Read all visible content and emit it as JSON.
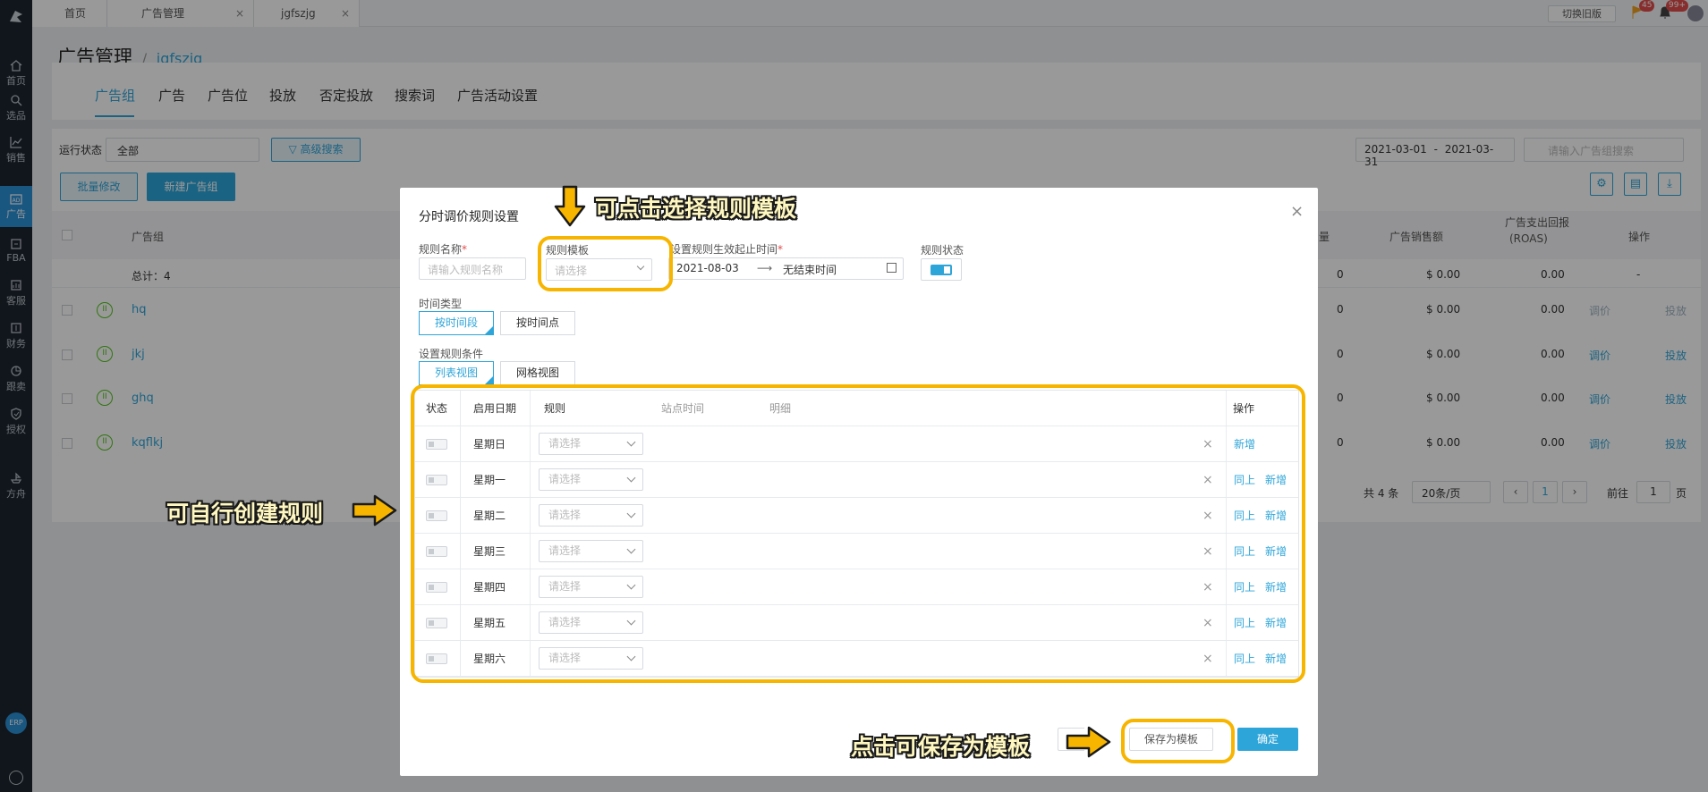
{
  "app": {
    "logo": "ERP"
  },
  "sidebar": {
    "items": [
      {
        "label": "首页",
        "icon": "home-icon"
      },
      {
        "label": "选品",
        "icon": "search-icon"
      },
      {
        "label": "销售",
        "icon": "chart-line-icon"
      },
      {
        "label": "广告",
        "icon": "ad-icon",
        "active": true
      },
      {
        "label": "FBA",
        "icon": "fba-icon"
      },
      {
        "label": "客服",
        "icon": "service-icon"
      },
      {
        "label": "财务",
        "icon": "finance-icon"
      },
      {
        "label": "跟卖",
        "icon": "follow-icon"
      },
      {
        "label": "授权",
        "icon": "shield-icon"
      },
      {
        "label": "方舟",
        "icon": "ark-icon"
      }
    ]
  },
  "page_tabs": [
    {
      "label": "首页"
    },
    {
      "label": "广告管理"
    },
    {
      "label": "jgfszjg"
    }
  ],
  "top_right": {
    "switch_label": "切换旧版",
    "flag_badge": "45",
    "bell_badge": "99+"
  },
  "breadcrumb": {
    "title": "广告管理",
    "sep": "/",
    "sub": "jgfszjg"
  },
  "nav_tabs": [
    "广告组",
    "广告",
    "广告位",
    "投放",
    "否定投放",
    "搜索词",
    "广告活动设置"
  ],
  "filters": {
    "status_label": "运行状态",
    "status_value": "全部",
    "advanced": "高级搜索",
    "date_start": "2021-03-01",
    "date_sep": "-",
    "date_end": "2021-03-31",
    "search_placeholder": "请输入广告组搜索"
  },
  "actions": {
    "batch_edit": "批量修改",
    "new_group": "新建广告组"
  },
  "table": {
    "headers": {
      "group": "广告组",
      "count_suffix": "量",
      "sales": "广告销售额",
      "roas": "广告支出回报",
      "roas_sub": "(ROAS)",
      "ops": "操作"
    },
    "total": "总计：4",
    "total_row": {
      "qty": "0",
      "sales": "$ 0.00",
      "roas": "0.00",
      "ops": "-"
    },
    "rows": [
      {
        "name": "hq",
        "qty": "0",
        "sales": "$ 0.00",
        "roas": "0.00",
        "op1": "调价",
        "op2": "投放",
        "dim": true
      },
      {
        "name": "jkj",
        "qty": "0",
        "sales": "$ 0.00",
        "roas": "0.00",
        "op1": "调价",
        "op2": "投放",
        "dim": false
      },
      {
        "name": "ghq",
        "qty": "0",
        "sales": "$ 0.00",
        "roas": "0.00",
        "op1": "调价",
        "op2": "投放",
        "dim": false
      },
      {
        "name": "kqflkj",
        "qty": "0",
        "sales": "$ 0.00",
        "roas": "0.00",
        "op1": "调价",
        "op2": "投放",
        "dim": false
      }
    ]
  },
  "pagination": {
    "total": "共 4 条",
    "page_size": "20条/页",
    "current": "1",
    "goto_label": "前往",
    "goto_value": "1",
    "page_suffix": "页"
  },
  "modal": {
    "title": "分时调价规则设置",
    "rule_name_label": "规则名称",
    "rule_name_placeholder": "请输入规则名称",
    "template_label": "规则模板",
    "template_placeholder": "请选择",
    "period_label": "设置规则生效起止时间",
    "period_start": "2021-08-03",
    "period_arrow": "⟶",
    "period_end": "无结束时间",
    "status_label": "规则状态",
    "time_type_label": "时间类型",
    "time_type_options": [
      "按时间段",
      "按时间点"
    ],
    "condition_label": "设置规则条件",
    "view_options": [
      "列表视图",
      "网格视图"
    ],
    "columns": {
      "status": "状态",
      "day": "启用日期",
      "rule": "规则",
      "site_time": "站点时间",
      "detail": "明细",
      "ops": "操作"
    },
    "rule_placeholder": "请选择",
    "days": [
      "星期日",
      "星期一",
      "星期二",
      "星期三",
      "星期四",
      "星期五",
      "星期六"
    ],
    "op_same": "同上",
    "op_add": "新增",
    "save_template": "保存为模板",
    "confirm": "确定"
  },
  "annotations": {
    "template_hint": "可点击选择规则模板",
    "create_hint": "可自行创建规则",
    "save_hint": "点击可保存为模板"
  },
  "colors": {
    "accent": "#2ea5d9",
    "sidebar": "#1d2630",
    "highlight": "#f7b500",
    "badge": "#e24c4c"
  }
}
